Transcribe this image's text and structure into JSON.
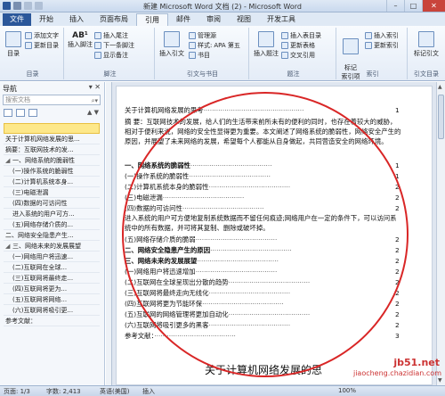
{
  "window": {
    "title": "新建 Microsoft Word 文档 (2) - Microsoft Word",
    "min": "–",
    "max": "□",
    "close": "✕"
  },
  "tabs": [
    "文件",
    "开始",
    "插入",
    "页面布局",
    "引用",
    "邮件",
    "审阅",
    "视图",
    "开发工具"
  ],
  "ribbon": {
    "toc_group": {
      "label": "目录",
      "toc_button": "目录",
      "add_text": "添加文字",
      "update_toc": "更新目录"
    },
    "footnote_group": {
      "label": "脚注",
      "insert_footnote": "插入脚注",
      "insert_endnote": "插入尾注",
      "next_footnote": "下一条脚注",
      "show_notes": "显示备注",
      "ab_label": "AB¹"
    },
    "citation_group": {
      "label": "引文与书目",
      "insert_citation": "插入引文",
      "manage_sources": "管理源",
      "style_label": "样式:",
      "style_value": "APA 第五",
      "bibliography": "书目"
    },
    "caption_group": {
      "label": "题注",
      "insert_caption": "插入题注",
      "insert_table_of_figures": "插入表目录",
      "update_table": "更新表格",
      "cross_reference": "交叉引用"
    },
    "index_group": {
      "label": "索引",
      "mark_entry": "标记\n索引项",
      "insert_index": "插入索引",
      "update_index": "更新索引"
    },
    "toa_group": {
      "label": "引文目录",
      "mark_citation": "标记引文"
    }
  },
  "nav": {
    "title": "导航",
    "search_placeholder": "搜索文档",
    "items": [
      {
        "text": "",
        "highlight": true,
        "indent": 0
      },
      {
        "text": "关于计算机网络发展的思...",
        "indent": 0
      },
      {
        "text": "摘要：互联网技术的发...",
        "indent": 0
      },
      {
        "text": "一、网络系统的脆弱性",
        "indent": 0,
        "tri": "◢"
      },
      {
        "text": "(一)操作系统的脆弱性",
        "indent": 1
      },
      {
        "text": "(二)计算机系统本身...",
        "indent": 1
      },
      {
        "text": "(三)电磁泄漏",
        "indent": 1
      },
      {
        "text": "(四)数据的可访问性",
        "indent": 1
      },
      {
        "text": "进入系统的用户可方...",
        "indent": 1
      },
      {
        "text": "(五)网络存储介质的...",
        "indent": 1
      },
      {
        "text": "二、网络安全隐患产生...",
        "indent": 0
      },
      {
        "text": "三、网络未来的发展展望",
        "indent": 0,
        "tri": "◢"
      },
      {
        "text": "(一)网络用户将迅速...",
        "indent": 1
      },
      {
        "text": "(二)互联网在全球...",
        "indent": 1
      },
      {
        "text": "(三)互联网将最终走...",
        "indent": 1
      },
      {
        "text": "(四)互联网将更为...",
        "indent": 1
      },
      {
        "text": "(五)互联网将网络...",
        "indent": 1
      },
      {
        "text": "(六)互联网将吸引更...",
        "indent": 1
      },
      {
        "text": "参考文献：",
        "indent": 0
      }
    ]
  },
  "document": {
    "toc_title": "关于计算机网络发展的思考",
    "toc_title_page": "1",
    "abstract": "摘 要：互联网技术的发展，给人们的生活带来前所未有的便利的同时，也存在着较大的威胁，相对于便利来说，网络的安全性显得更为重要。本文阐述了网络系统的脆弱性，网络安全产生的原因，并展望了未来网络的发展，希望每个人都能从自身做起，共同营造安全的网络环境。",
    "abstract_page": "1",
    "toc_entries": [
      {
        "text": "一、网络系统的脆弱性",
        "page": "1",
        "bold": true
      },
      {
        "text": "(一)操作系统的脆弱性",
        "page": "1"
      },
      {
        "text": "(二)计算机系统本身的脆弱性",
        "page": "2"
      },
      {
        "text": "(三)电磁泄漏",
        "page": "2"
      },
      {
        "text": "(四)数据的可访问性",
        "page": "2"
      }
    ],
    "entry_para": "进入系统的用户可方便地复制系统数据而不留任何痕迹;网络用户在一定的条件下，可以访问系统中的所有数据，并可将其复制、删除或破坏掉。",
    "entry_para_page": "2",
    "toc_entries2": [
      {
        "text": "(五)网络存储介质的脆弱",
        "page": "2"
      },
      {
        "text": "二、网络安全隐患产生的原因",
        "page": "2",
        "bold": true
      },
      {
        "text": "三、网络未来的发展展望",
        "page": "2",
        "bold": true
      },
      {
        "text": "(一)网络用户将迅速增加",
        "page": "2"
      },
      {
        "text": "(二)互联网在全球呈现出分散的趋势",
        "page": "2"
      },
      {
        "text": "(三)互联网将最终走向无线化",
        "page": "2"
      },
      {
        "text": "(四)互联网将更为节能环保",
        "page": "2"
      },
      {
        "text": "(五)互联网的网络管理将更加自动化",
        "page": "2"
      },
      {
        "text": "(六)互联网将吸引更多的黑客",
        "page": "2"
      },
      {
        "text": "参考文献：",
        "page": "3"
      }
    ],
    "big_title": "关于计算机网络发展的思"
  },
  "status": {
    "page": "页面: 1/3",
    "words": "字数: 2,413",
    "lang": "英语(美国)",
    "mode": "插入",
    "zoom": "100%"
  },
  "watermark": {
    "site": "jb51.net",
    "sub": "jiaocheng.chazidian.com"
  },
  "colors": {
    "file_tab": "#2b579a",
    "annotation_ellipse": "#d92626"
  }
}
